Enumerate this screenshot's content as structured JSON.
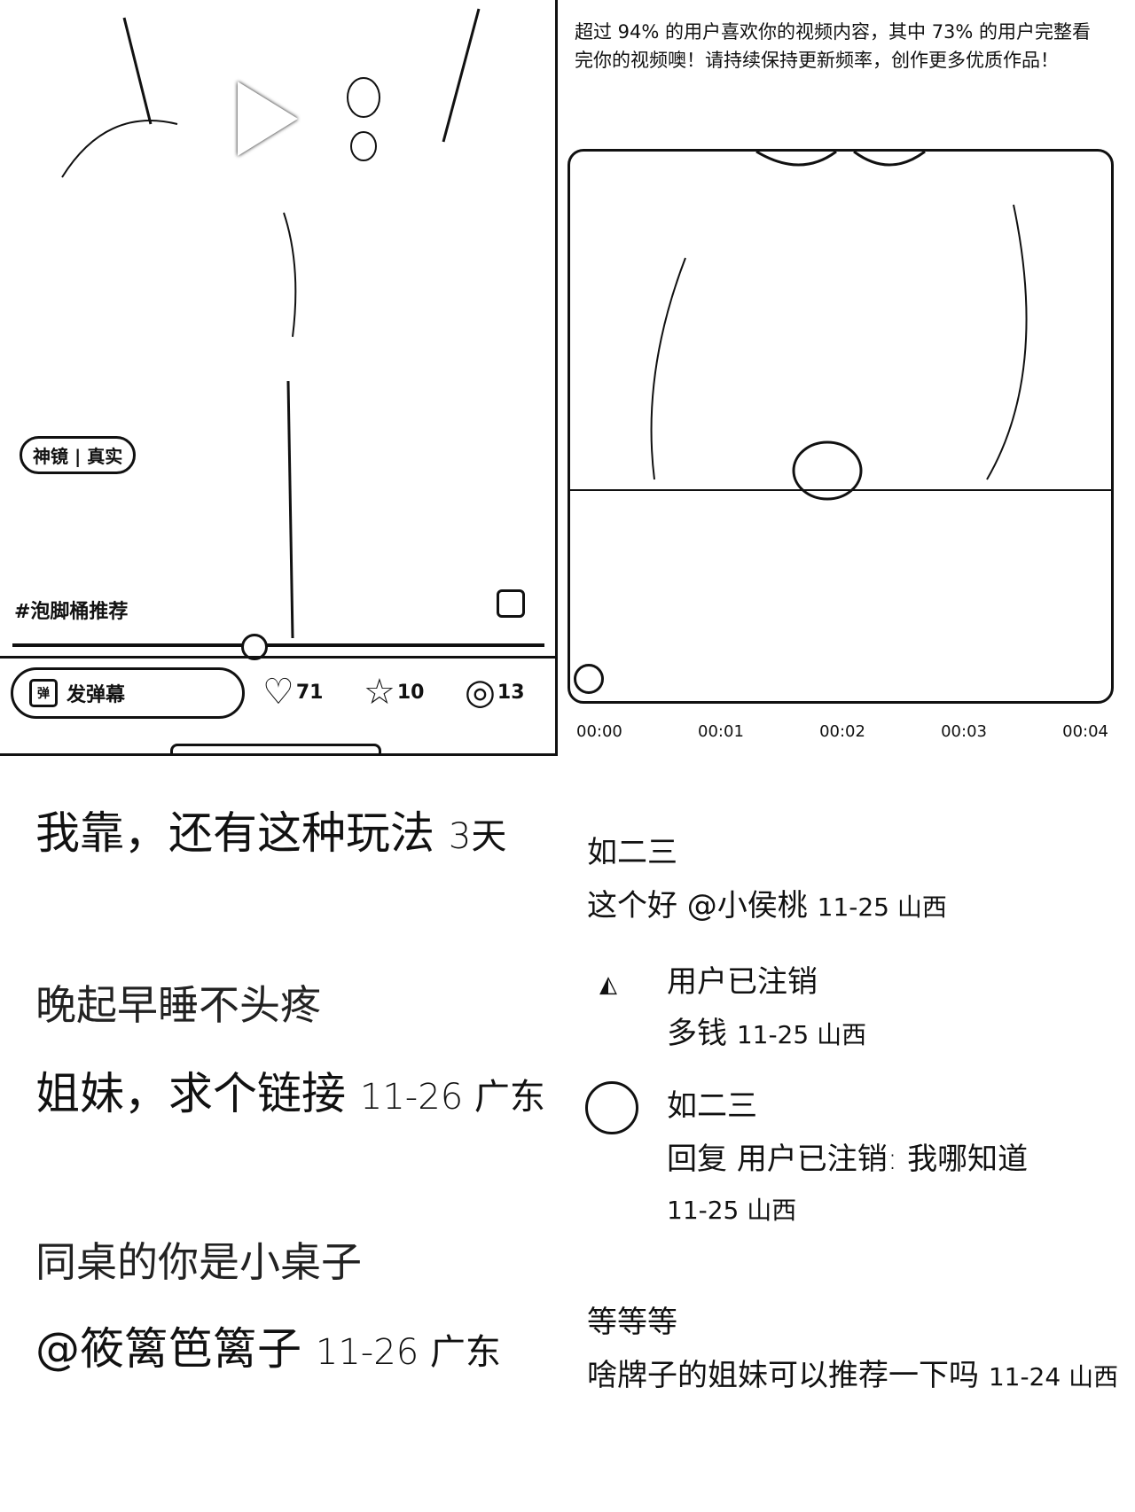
{
  "video_player": {
    "tag_label": "神镜 | 真实",
    "hashtag": "#泡脚桶推荐",
    "danmu_icon": "弹",
    "danmu_placeholder": "发弹幕",
    "likes": "71",
    "favorites": "10",
    "comments": "13",
    "progress_fraction": 0.45
  },
  "analysis": {
    "summary": "超过 94% 的用户喜欢你的视频内容，其中 73% 的用户完整看完你的视频噢！请持续保持更新频率，创作更多优质作品！",
    "timeline": [
      "00:00",
      "00:01",
      "00:02",
      "00:03",
      "00:04"
    ]
  },
  "comments_left": [
    {
      "text": "我靠，还有这种玩法",
      "meta": "3天"
    },
    {
      "user": "晚起早睡不头疼",
      "text": "姐妹，求个链接",
      "meta": "11-26 广东"
    },
    {
      "user": "同桌的你是小桌子",
      "text": "@筱篱笆篱子",
      "meta": "11-26 广东"
    }
  ],
  "comments_right": [
    {
      "user": "如二三",
      "text": "这个好 @小侯桃",
      "meta": "11-25 山西"
    },
    {
      "user": "用户已注销",
      "text": "多钱",
      "meta": "11-25 山西"
    },
    {
      "user": "如二三",
      "reply_prefix": "回复",
      "reply_to": "用户已注销:",
      "text": "我哪知道",
      "meta": "11-25 山西"
    },
    {
      "user": "等等等",
      "text": "啥牌子的姐妹可以推荐一下吗",
      "meta": "11-24 山西"
    }
  ],
  "icons": {
    "like": "heart-icon",
    "favorite": "star-icon",
    "comment": "chat-bubble-icon",
    "expand": "fullscreen-icon",
    "play": "play-icon"
  }
}
